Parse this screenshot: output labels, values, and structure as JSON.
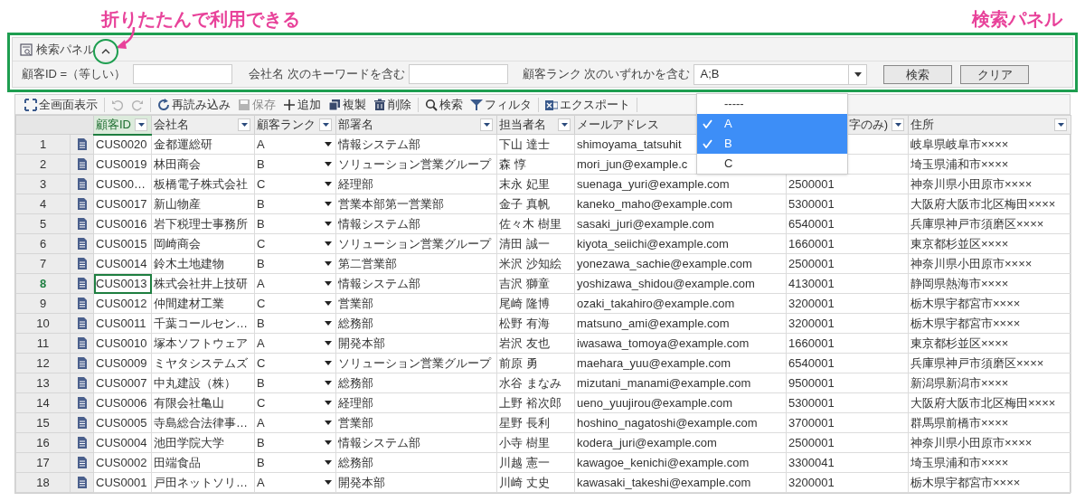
{
  "annotations": [
    {
      "kind": "callout",
      "text": "折りたたんで利用できる"
    },
    {
      "kind": "label",
      "text": "検索パネル"
    }
  ],
  "search_panel": {
    "title": "検索パネル",
    "expanded": true,
    "filters": [
      {
        "kind": "text",
        "label": "顧客ID =（等しい）"
      },
      {
        "kind": "text",
        "label": "会社名 次のキーワードを含む"
      },
      {
        "kind": "select",
        "label": "顧客ランク 次のいずれかを含む",
        "value": "A;B"
      }
    ],
    "buttons": [
      "検索",
      "クリア"
    ]
  },
  "toolbar": [
    {
      "label": "全画面表示",
      "disabled": false
    },
    {
      "disabled": true
    },
    {
      "disabled": true
    },
    {
      "label": "再読み込み",
      "disabled": false
    },
    {
      "label": "保存",
      "disabled": true
    },
    {
      "label": "追加",
      "disabled": false
    },
    {
      "label": "複製",
      "disabled": false
    },
    {
      "label": "削除",
      "disabled": false
    },
    {
      "label": "検索",
      "disabled": false
    },
    {
      "label": "フィルタ",
      "disabled": false
    },
    {
      "label": "エクスポート",
      "disabled": false
    }
  ],
  "dropdown": {
    "options": [
      {
        "label": "-----",
        "selected": false
      },
      {
        "label": "A",
        "selected": true
      },
      {
        "label": "B",
        "selected": true
      },
      {
        "label": "C",
        "selected": false
      }
    ]
  },
  "table": {
    "columns": [
      {
        "label": "顧客ID",
        "selected": true,
        "filter": true
      },
      {
        "label": "会社名",
        "selected": false,
        "filter": true
      },
      {
        "label": "顧客ランク",
        "selected": false,
        "filter": true
      },
      {
        "label": "部署名",
        "selected": false,
        "filter": true
      },
      {
        "label": "担当者名",
        "selected": false,
        "filter": true
      },
      {
        "label": "メールアドレス",
        "selected": false,
        "filter": false
      },
      {
        "label": "字のみ)",
        "selected": false,
        "filter": true
      },
      {
        "label": "住所",
        "selected": false,
        "filter": true
      }
    ],
    "rows": [
      {
        "number": "1",
        "current": false,
        "cells": [
          "CUS0020",
          "金都運総研",
          "A",
          "情報システム部",
          "下山 達士",
          "shimoyama_tatsuhit",
          null,
          "岐阜県岐阜市××××"
        ]
      },
      {
        "number": "2",
        "current": false,
        "cells": [
          "CUS0019",
          "林田商会",
          "B",
          "ソリューション営業グループ",
          "森 惇",
          "mori_jun@example.c",
          null,
          "埼玉県浦和市××××"
        ]
      },
      {
        "number": "3",
        "current": false,
        "cells": [
          "CUS00…",
          "板橋電子株式会社",
          "C",
          "経理部",
          "末永 妃里",
          "suenaga_yuri@example.com",
          "2500001",
          "神奈川県小田原市××××"
        ]
      },
      {
        "number": "4",
        "current": false,
        "cells": [
          "CUS0017",
          "新山物産",
          "B",
          "営業本部第一営業部",
          "金子 真帆",
          "kaneko_maho@example.com",
          "5300001",
          "大阪府大阪市北区梅田××××"
        ]
      },
      {
        "number": "5",
        "current": false,
        "cells": [
          "CUS0016",
          "岩下税理士事務所",
          "B",
          "情報システム部",
          "佐々木 樹里",
          "sasaki_juri@example.com",
          "6540001",
          "兵庫県神戸市須磨区××××"
        ]
      },
      {
        "number": "6",
        "current": false,
        "cells": [
          "CUS0015",
          "岡崎商会",
          "C",
          "ソリューション営業グループ",
          "清田 誠一",
          "kiyota_seiichi@example.com",
          "1660001",
          "東京都杉並区××××"
        ]
      },
      {
        "number": "7",
        "current": false,
        "cells": [
          "CUS0014",
          "鈴木土地建物",
          "B",
          "第二営業部",
          "米沢 沙知絵",
          "yonezawa_sachie@example.com",
          "2500001",
          "神奈川県小田原市××××"
        ]
      },
      {
        "number": "8",
        "current": true,
        "cells": [
          "CUS0013",
          "株式会社井上技研",
          "A",
          "情報システム部",
          "吉沢 獅童",
          "yoshizawa_shidou@example.com",
          "4130001",
          "静岡県熱海市××××"
        ]
      },
      {
        "number": "9",
        "current": false,
        "cells": [
          "CUS0012",
          "仲間建材工業",
          "C",
          "営業部",
          "尾崎 隆博",
          "ozaki_takahiro@example.com",
          "3200001",
          "栃木県宇都宮市××××"
        ]
      },
      {
        "number": "10",
        "current": false,
        "cells": [
          "CUS0011",
          "千葉コールセン…",
          "B",
          "総務部",
          "松野 有海",
          "matsuno_ami@example.com",
          "3200001",
          "栃木県宇都宮市××××"
        ]
      },
      {
        "number": "11",
        "current": false,
        "cells": [
          "CUS0010",
          "塚本ソフトウェア",
          "A",
          "開発本部",
          "岩沢 友也",
          "iwasawa_tomoya@example.com",
          "1660001",
          "東京都杉並区××××"
        ]
      },
      {
        "number": "12",
        "current": false,
        "cells": [
          "CUS0009",
          "ミヤタシステムズ",
          "C",
          "ソリューション営業グループ",
          "前原 勇",
          "maehara_yuu@example.com",
          "6540001",
          "兵庫県神戸市須磨区××××"
        ]
      },
      {
        "number": "13",
        "current": false,
        "cells": [
          "CUS0007",
          "中丸建設（株）",
          "B",
          "総務部",
          "水谷 まなみ",
          "mizutani_manami@example.com",
          "9500001",
          "新潟県新潟市××××"
        ]
      },
      {
        "number": "14",
        "current": false,
        "cells": [
          "CUS0006",
          "有限会社亀山",
          "C",
          "経理部",
          "上野 裕次郎",
          "ueno_yuujirou@example.com",
          "5300001",
          "大阪府大阪市北区梅田××××"
        ]
      },
      {
        "number": "15",
        "current": false,
        "cells": [
          "CUS0005",
          "寺島総合法律事…",
          "A",
          "営業部",
          "星野 長利",
          "hoshino_nagatoshi@example.com",
          "3700001",
          "群馬県前橋市××××"
        ]
      },
      {
        "number": "16",
        "current": false,
        "cells": [
          "CUS0004",
          "池田学院大学",
          "B",
          "情報システム部",
          "小寺 樹里",
          "kodera_juri@example.com",
          "2500001",
          "神奈川県小田原市××××"
        ]
      },
      {
        "number": "17",
        "current": false,
        "cells": [
          "CUS0002",
          "田端食品",
          "B",
          "総務部",
          "川越 憲一",
          "kawagoe_kenichi@example.com",
          "3300041",
          "埼玉県浦和市××××"
        ]
      },
      {
        "number": "18",
        "current": false,
        "cells": [
          "CUS0001",
          "戸田ネットソリ…",
          "A",
          "開発本部",
          "川崎 丈史",
          "kawasaki_takeshi@example.com",
          "3200001",
          "栃木県宇都宮市××××"
        ]
      }
    ]
  }
}
